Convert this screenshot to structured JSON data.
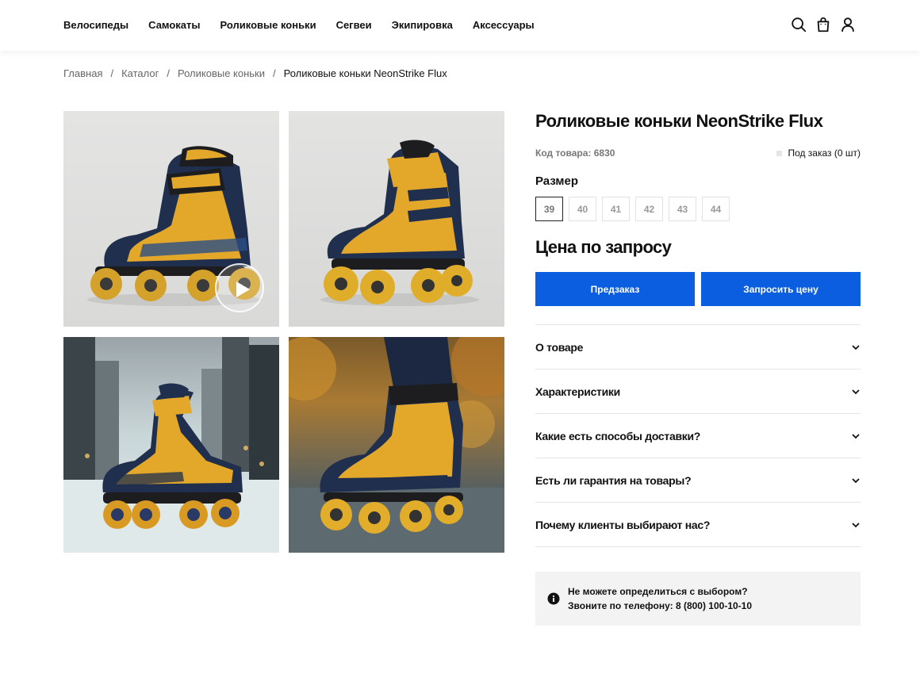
{
  "nav": {
    "items": [
      "Велосипеды",
      "Самокаты",
      "Роликовые коньки",
      "Сегвеи",
      "Экипировка",
      "Аксессуары"
    ],
    "icons": [
      "search-icon",
      "cart-icon",
      "user-icon"
    ]
  },
  "breadcrumb": {
    "home": "Главная",
    "catalog": "Каталог",
    "category": "Роликовые коньки",
    "current": "Роликовые коньки NeonStrike Flux",
    "separator": "/"
  },
  "product": {
    "title": "Роликовые коньки NeonStrike Flux",
    "code": "Код товара: 6830",
    "stock": "Под заказ (0 шт)",
    "size_label": "Размер",
    "sizes": [
      "39",
      "40",
      "41",
      "42",
      "43",
      "44"
    ],
    "selected_size": "39",
    "price": "Цена по запросу",
    "preorder_label": "Предзаказ",
    "request_price_label": "Запросить цену"
  },
  "accordion": [
    "О товаре",
    "Характеристики",
    "Какие есть способы доставки?",
    "Есть ли гарантия на товары?",
    "Почему клиенты выбирают нас?"
  ],
  "help": {
    "line1": "Не можете определиться с выбором?",
    "line2": "Звоните по телефону: 8 (800) 100-10-10"
  },
  "colors": {
    "accent": "#0b5ee0",
    "help_bg": "#f3f3f3",
    "skate_yellow": "#e3a82a",
    "skate_navy": "#1f2f4d"
  }
}
